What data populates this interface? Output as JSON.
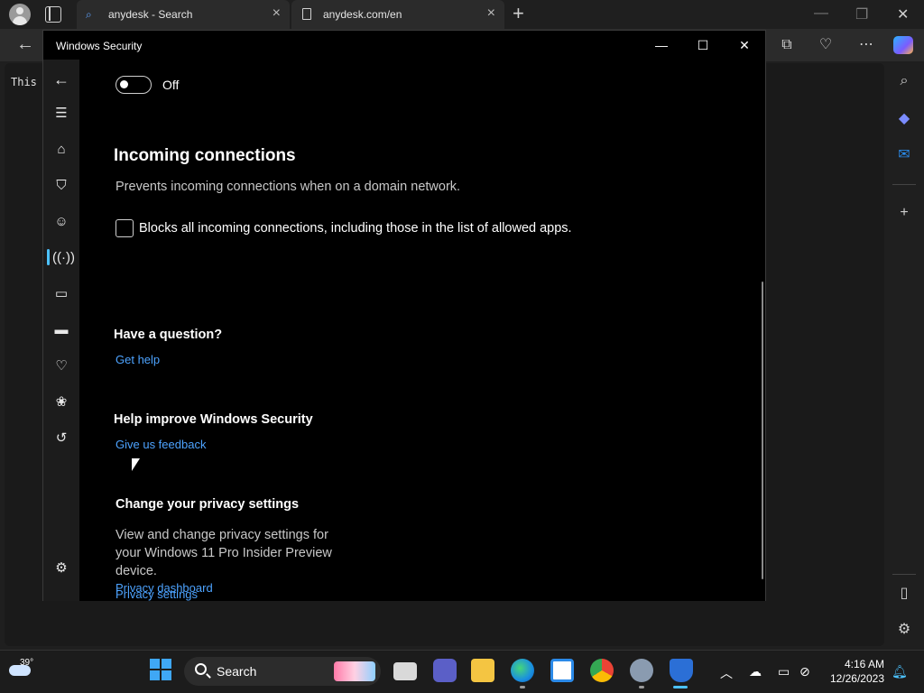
{
  "browser": {
    "tabs": [
      {
        "label": "anydesk - Search",
        "icon": "search-icon"
      },
      {
        "label": "anydesk.com/en",
        "icon": "document-icon"
      }
    ],
    "page_text": "This"
  },
  "window": {
    "title": "Windows Security",
    "controls": {
      "minimize": "—",
      "maximize": "☐",
      "close": "✕"
    }
  },
  "content": {
    "toggle_state": "Off",
    "incoming_heading": "Incoming connections",
    "incoming_desc": "Prevents incoming connections when on a domain network.",
    "checkbox_label": "Blocks all incoming connections, including those in the list of allowed apps.",
    "question_heading": "Have a question?",
    "get_help_link": "Get help",
    "improve_heading": "Help improve Windows Security",
    "feedback_link": "Give us feedback",
    "privacy_heading": "Change your privacy settings",
    "privacy_desc": "View and change privacy settings for your Windows 11 Pro Insider Preview device.",
    "privacy_settings_link": "Privacy settings",
    "privacy_dashboard_link": "Privacy dashboard"
  },
  "taskbar": {
    "temperature": "39°",
    "search_label": "Search",
    "time": "4:16 AM",
    "date": "12/26/2023"
  },
  "colors": {
    "accent": "#4cc2ff",
    "link": "#4da3ff"
  }
}
